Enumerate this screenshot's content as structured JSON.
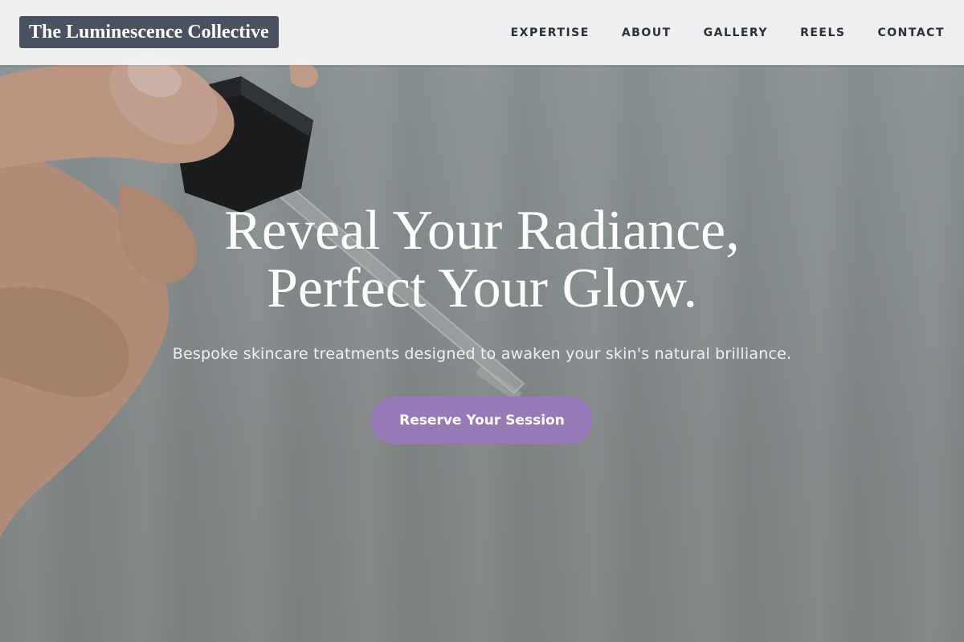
{
  "brand": {
    "name": "The Luminescence Collective"
  },
  "nav": {
    "items": [
      {
        "label": "EXPERTISE"
      },
      {
        "label": "ABOUT"
      },
      {
        "label": "GALLERY"
      },
      {
        "label": "REELS"
      },
      {
        "label": "CONTACT"
      }
    ]
  },
  "hero": {
    "headline_line1": "Reveal Your Radiance,",
    "headline_line2": "Perfect Your Glow.",
    "subheadline": "Bespoke skincare treatments designed to awaken your skin's natural brilliance.",
    "cta_label": "Reserve Your Session",
    "background_image": "hand holding serum dropper pipette"
  },
  "colors": {
    "brand_bg": "#4a5161",
    "cta_bg": "#987ab8",
    "header_bg": "#f3f2f5",
    "nav_text": "#2b2f3a"
  }
}
